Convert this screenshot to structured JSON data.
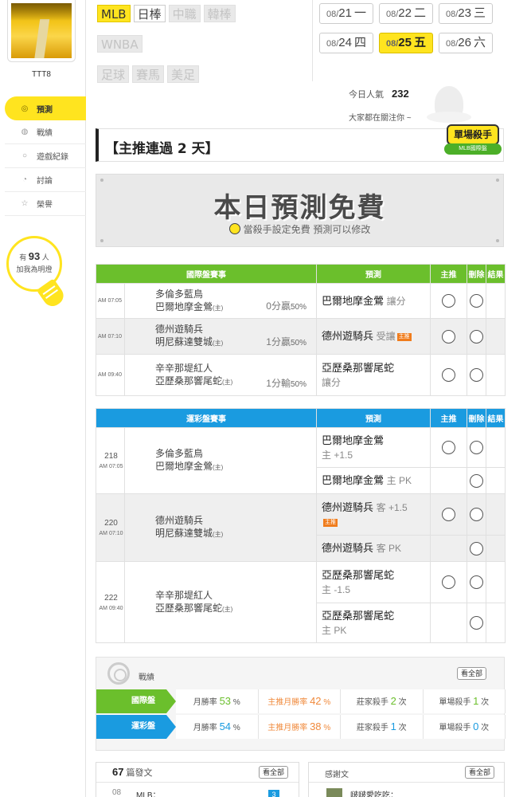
{
  "sidebar": {
    "username": "TTT8",
    "nav": [
      {
        "label": "預測",
        "icon": "target-icon"
      },
      {
        "label": "戰績",
        "icon": "stats-icon"
      },
      {
        "label": "遊戲紀錄",
        "icon": "record-icon"
      },
      {
        "label": "討論",
        "icon": "discuss-icon"
      },
      {
        "label": "榮譽",
        "icon": "honor-icon"
      }
    ],
    "bulb": {
      "prefix": "有",
      "count": "93",
      "suffix": "人",
      "line2": "加我為明燈"
    }
  },
  "leagues": {
    "row1": [
      "MLB",
      "日棒",
      "中職",
      "韓棒"
    ],
    "row2": [
      "WNBA"
    ],
    "row3": [
      "足球",
      "賽馬",
      "美足"
    ]
  },
  "dates": [
    {
      "md": "08/",
      "d": "21",
      "w": "一"
    },
    {
      "md": "08/",
      "d": "22",
      "w": "二"
    },
    {
      "md": "08/",
      "d": "23",
      "w": "三"
    },
    {
      "md": "08/",
      "d": "24",
      "w": "四"
    },
    {
      "md": "08/",
      "d": "25",
      "w": "五"
    },
    {
      "md": "08/",
      "d": "26",
      "w": "六"
    }
  ],
  "popularity": {
    "label": "今日人氣",
    "value": "232",
    "note": "大家都在關注你 ~"
  },
  "headline": "【主推連過 2 天】",
  "killer_badge": {
    "title": "單場殺手",
    "sub": "MLB國際盤"
  },
  "free_banner": {
    "title": "本日預測免費",
    "sub": "當殺手設定免費 預測可以修改"
  },
  "intl_table": {
    "headers": [
      "國際盤賽事",
      "預測",
      "主推",
      "刪除",
      "結果"
    ],
    "rows": [
      {
        "time": "AM 07:05",
        "away": "多倫多藍鳥",
        "home": "巴爾地摩金鶯",
        "home_tag": "(主)",
        "odds": "0分贏",
        "pct": "50%",
        "pred": "巴爾地摩金鶯",
        "pred_type": "讓分",
        "tag": ""
      },
      {
        "time": "AM 07:10",
        "away": "德州遊騎兵",
        "home": "明尼蘇達雙城",
        "home_tag": "(主)",
        "odds": "1分贏",
        "pct": "50%",
        "pred": "德州遊騎兵",
        "pred_type": "受讓",
        "tag": "主推"
      },
      {
        "time": "AM 09:40",
        "away": "辛辛那堤紅人",
        "home": "亞歷桑那響尾蛇",
        "home_tag": "(主)",
        "odds": "1分輸",
        "pct": "50%",
        "pred": "亞歷桑那響尾蛇",
        "pred_type": "讓分",
        "tag": ""
      }
    ]
  },
  "lott_table": {
    "headers": [
      "運彩盤賽事",
      "預測",
      "主推",
      "刪除",
      "結果"
    ],
    "games": [
      {
        "num": "218",
        "time": "AM 07:05",
        "away": "多倫多藍鳥",
        "home": "巴爾地摩金鶯",
        "home_tag": "(主)",
        "preds": [
          {
            "team": "巴爾地摩金鶯",
            "detail": "主 +1.5",
            "tag": ""
          },
          {
            "team": "巴爾地摩金鶯",
            "detail": "主 PK",
            "tag": ""
          }
        ]
      },
      {
        "num": "220",
        "time": "AM 07:10",
        "away": "德州遊騎兵",
        "home": "明尼蘇達雙城",
        "home_tag": "(主)",
        "preds": [
          {
            "team": "德州遊騎兵",
            "detail": "客 +1.5",
            "tag": "主推"
          },
          {
            "team": "德州遊騎兵",
            "detail": "客 PK",
            "tag": ""
          }
        ]
      },
      {
        "num": "222",
        "time": "AM 09:40",
        "away": "辛辛那堤紅人",
        "home": "亞歷桑那響尾蛇",
        "home_tag": "(主)",
        "preds": [
          {
            "team": "亞歷桑那響尾蛇",
            "detail": "主 -1.5",
            "tag": ""
          },
          {
            "team": "亞歷桑那響尾蛇",
            "detail": "主 PK",
            "tag": ""
          }
        ]
      }
    ]
  },
  "stats": {
    "title": "戰績",
    "see_all": "看全部",
    "rows": [
      {
        "label": "國際盤",
        "month_label": "月勝率",
        "month": "53",
        "main_label": "主推月勝率",
        "main": "42",
        "pct": "%",
        "dealer_label": "莊家殺手",
        "dealer": "2",
        "single_label": "單場殺手",
        "single": "1",
        "unit": "次"
      },
      {
        "label": "運彩盤",
        "month_label": "月勝率",
        "month": "54",
        "main_label": "主推月勝率",
        "main": "38",
        "pct": "%",
        "dealer_label": "莊家殺手",
        "dealer": "1",
        "single_label": "單場殺手",
        "single": "0",
        "unit": "次"
      }
    ]
  },
  "posts": {
    "count": "67",
    "label": "篇發文",
    "see_all": "看全部",
    "first_day": "08",
    "first_title": "MLB：",
    "first_badge": "3"
  },
  "thanks": {
    "label": "感謝文",
    "see_all": "看全部",
    "first_user": "啵啵愛吃吃："
  }
}
